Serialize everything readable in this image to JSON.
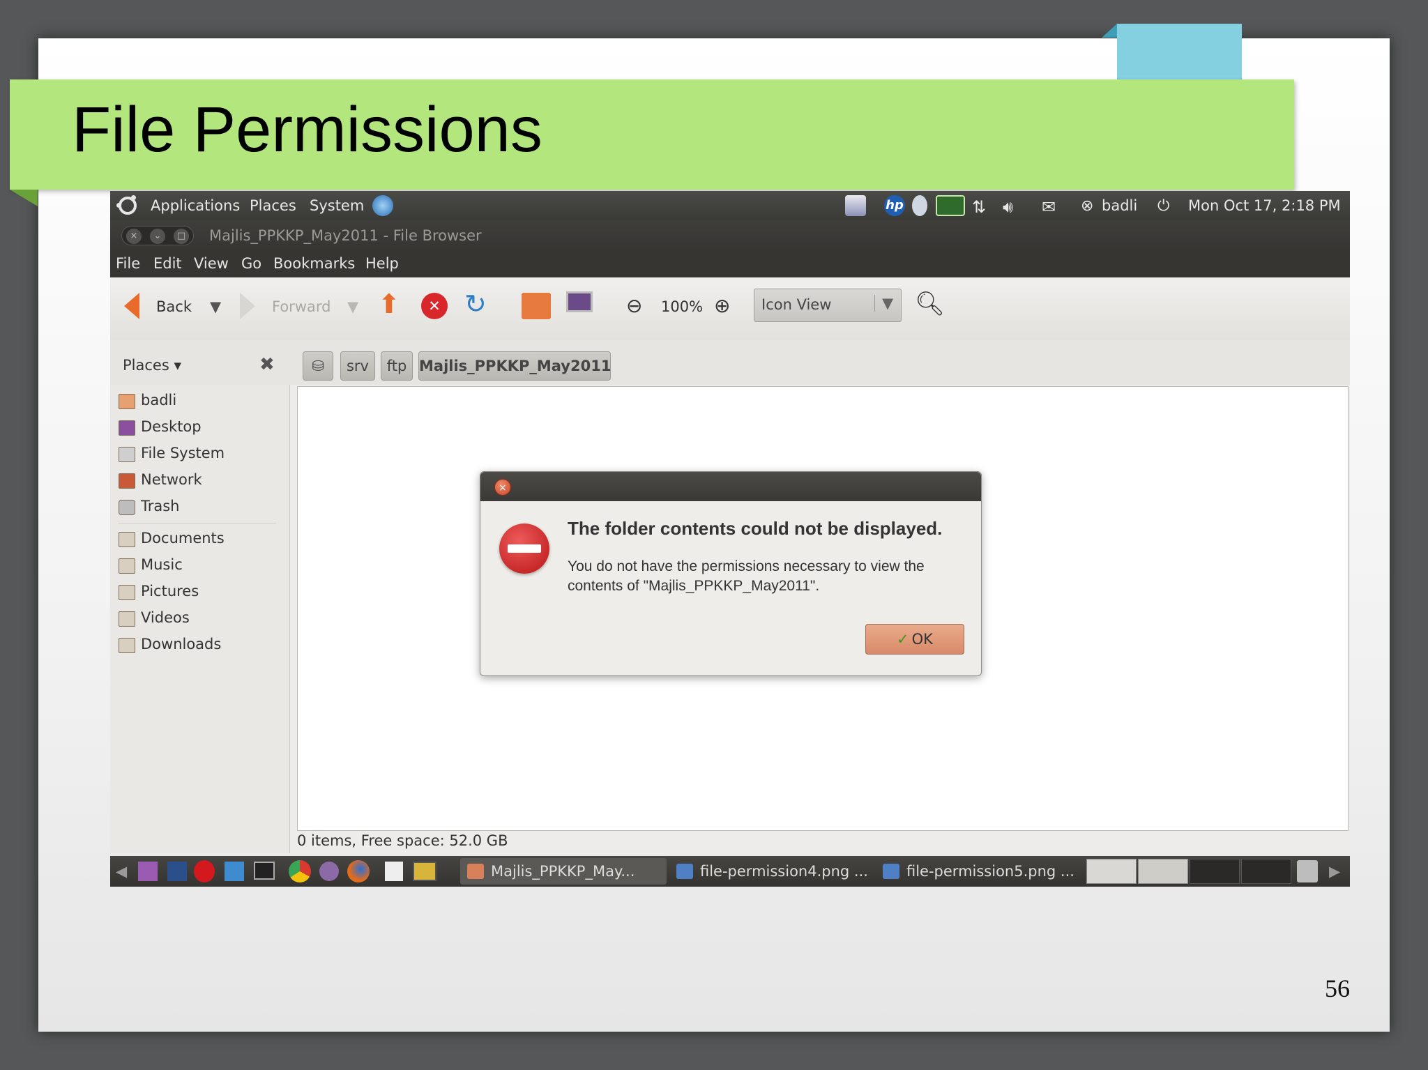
{
  "slide": {
    "title": "File Permissions",
    "page_number": "56"
  },
  "top_panel": {
    "menus": [
      "Applications",
      "Places",
      "System"
    ],
    "user": "badli",
    "clock": "Mon Oct 17,  2:18 PM"
  },
  "window": {
    "title": "Majlis_PPKKP_May2011 - File Browser",
    "menu": [
      "File",
      "Edit",
      "View",
      "Go",
      "Bookmarks",
      "Help"
    ]
  },
  "toolbar": {
    "back": "Back",
    "forward": "Forward",
    "zoom": "100%",
    "view_mode": "Icon View"
  },
  "pathbar": {
    "crumbs": [
      "srv",
      "ftp",
      "Majlis_PPKKP_May2011"
    ]
  },
  "sidebar": {
    "header": "Places",
    "items": [
      "badli",
      "Desktop",
      "File System",
      "Network",
      "Trash"
    ],
    "bookmarks": [
      "Documents",
      "Music",
      "Pictures",
      "Videos",
      "Downloads"
    ]
  },
  "status": "0 items, Free space: 52.0 GB",
  "dialog": {
    "primary": "The folder contents could not be displayed.",
    "secondary": "You do not have the permissions necessary to view the contents of \"Majlis_PPKKP_May2011\".",
    "ok": "OK"
  },
  "taskbar": {
    "tasks": [
      "Majlis_PPKKP_May...",
      "file-permission4.png ...",
      "file-permission5.png ..."
    ]
  },
  "colors": {
    "title_band": "#b3e77e",
    "accent_blue": "#84cfe0",
    "panel_dark": "#3a3a37",
    "error_red": "#c81e1e"
  }
}
